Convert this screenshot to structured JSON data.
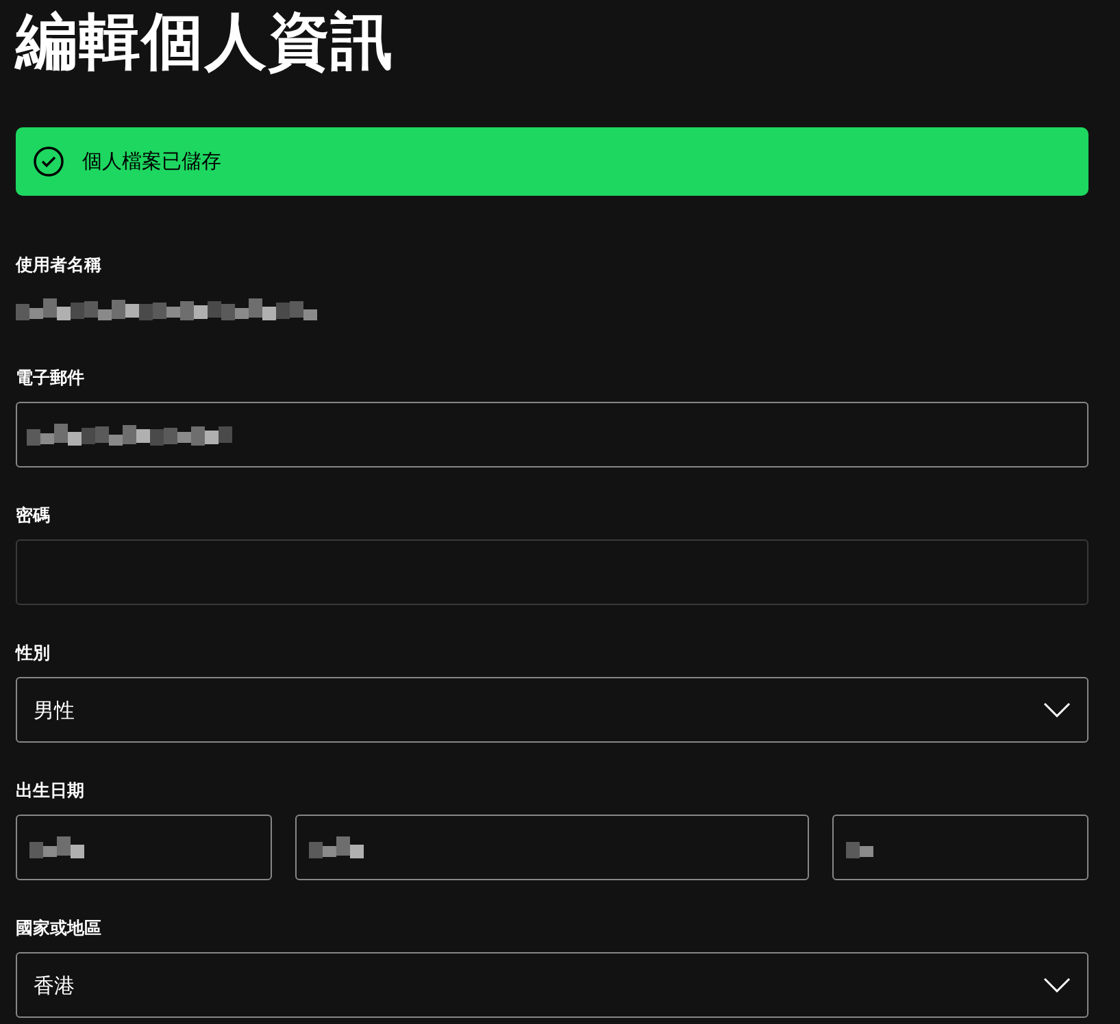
{
  "title": "編輯個人資訊",
  "banner": {
    "message": "個人檔案已儲存"
  },
  "fields": [
    {
      "kind": "static",
      "label": "使用者名稱"
    },
    {
      "kind": "text",
      "label": "電子郵件"
    },
    {
      "kind": "password",
      "label": "密碼"
    },
    {
      "kind": "select",
      "label": "性別",
      "value": "男性"
    },
    {
      "kind": "date",
      "label": "出生日期"
    },
    {
      "kind": "select",
      "label": "國家或地區",
      "value": "香港"
    }
  ]
}
